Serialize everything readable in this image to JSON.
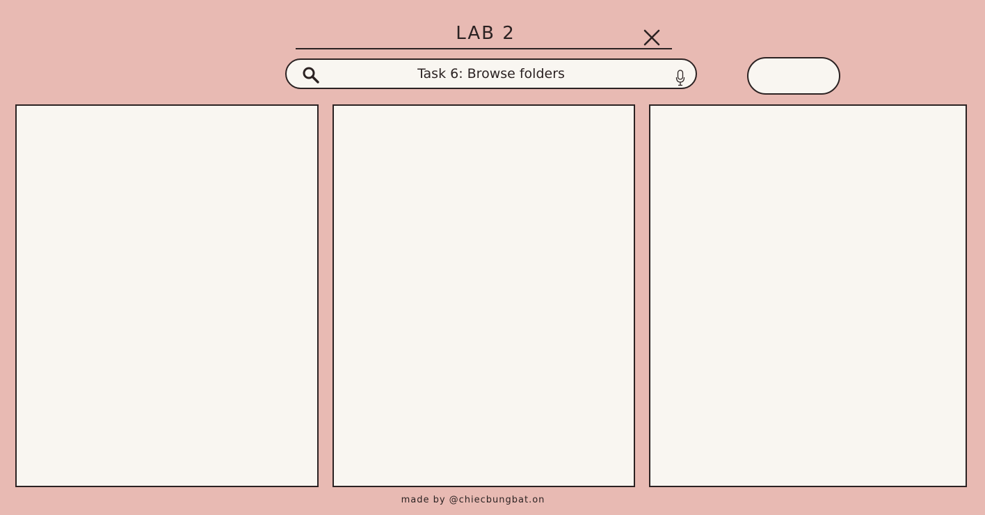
{
  "header": {
    "title": "LAB 2",
    "close_icon": "close-icon"
  },
  "search": {
    "text": "Task 6: Browse folders",
    "search_icon": "search-icon",
    "mic_icon": "microphone-icon"
  },
  "action_button": {
    "label": ""
  },
  "panels": [
    {
      "content": ""
    },
    {
      "content": ""
    },
    {
      "content": ""
    }
  ],
  "footer": {
    "credit": "made by @chiecbungbat.on"
  },
  "colors": {
    "background": "#e8bab3",
    "panel": "#f9f6f1",
    "ink": "#2b2222"
  }
}
